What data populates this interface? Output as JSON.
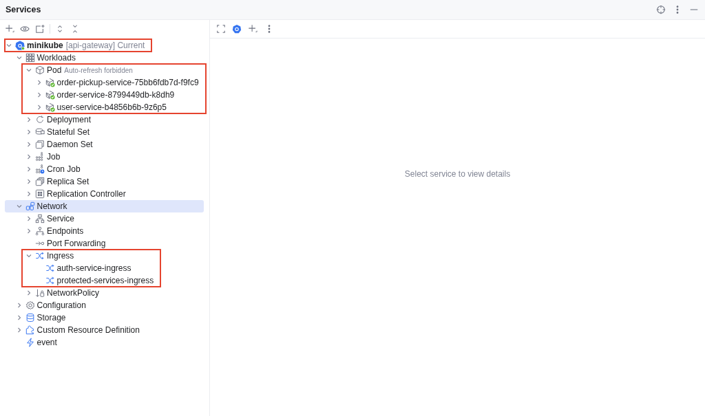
{
  "window": {
    "title": "Services"
  },
  "tree": [
    {
      "label": "minikube",
      "detail": "[api-gateway] Current",
      "kind": "cluster",
      "expanded": true,
      "selected": false,
      "highlighted": true,
      "children": [
        {
          "label": "Workloads",
          "kind": "workloads",
          "expanded": true,
          "selected": false,
          "children": [
            {
              "label": "Pod",
              "detail": "Auto-refresh forbidden",
              "kind": "pod",
              "expanded": true,
              "selected": false,
              "highlighted": true,
              "children": [
                {
                  "label": "order-pickup-service-75bb6fdb7d-f9fc9",
                  "kind": "podrunning",
                  "expanded": false,
                  "selected": false
                },
                {
                  "label": "order-service-8799449db-k8dh9",
                  "kind": "podrunning",
                  "expanded": false,
                  "selected": false
                },
                {
                  "label": "user-service-b4856b6b-9z6p5",
                  "kind": "podrunning",
                  "expanded": false,
                  "selected": false
                }
              ]
            },
            {
              "label": "Deployment",
              "kind": "deployment",
              "expanded": false,
              "selected": false
            },
            {
              "label": "Stateful Set",
              "kind": "statefulset",
              "expanded": false,
              "selected": false
            },
            {
              "label": "Daemon Set",
              "kind": "daemonset",
              "expanded": false,
              "selected": false
            },
            {
              "label": "Job",
              "kind": "job",
              "expanded": false,
              "selected": false
            },
            {
              "label": "Cron Job",
              "kind": "cronjob",
              "expanded": false,
              "selected": false
            },
            {
              "label": "Replica Set",
              "kind": "replicaset",
              "expanded": false,
              "selected": false
            },
            {
              "label": "Replication Controller",
              "kind": "replication",
              "expanded": false,
              "selected": false
            }
          ]
        },
        {
          "label": "Network",
          "kind": "network",
          "expanded": true,
          "selected": true,
          "children": [
            {
              "label": "Service",
              "kind": "service",
              "expanded": false,
              "selected": false
            },
            {
              "label": "Endpoints",
              "kind": "endpoints",
              "expanded": false,
              "selected": false
            },
            {
              "label": "Port Forwarding",
              "kind": "portforward",
              "selected": false
            },
            {
              "label": "Ingress",
              "kind": "ingress",
              "expanded": true,
              "selected": false,
              "highlighted": true,
              "children": [
                {
                  "label": "auth-service-ingress",
                  "kind": "ingress",
                  "selected": false
                },
                {
                  "label": "protected-services-ingress",
                  "kind": "ingress",
                  "selected": false
                }
              ]
            },
            {
              "label": "NetworkPolicy",
              "kind": "networkpolicy",
              "expanded": false,
              "selected": false
            }
          ]
        },
        {
          "label": "Configuration",
          "kind": "configuration",
          "expanded": false,
          "selected": false
        },
        {
          "label": "Storage",
          "kind": "storage",
          "expanded": false,
          "selected": false
        },
        {
          "label": "Custom Resource Definition",
          "kind": "crd",
          "expanded": false,
          "selected": false
        },
        {
          "label": "event",
          "kind": "event",
          "selected": false
        }
      ]
    }
  ],
  "details": {
    "placeholder": "Select service to view details"
  }
}
